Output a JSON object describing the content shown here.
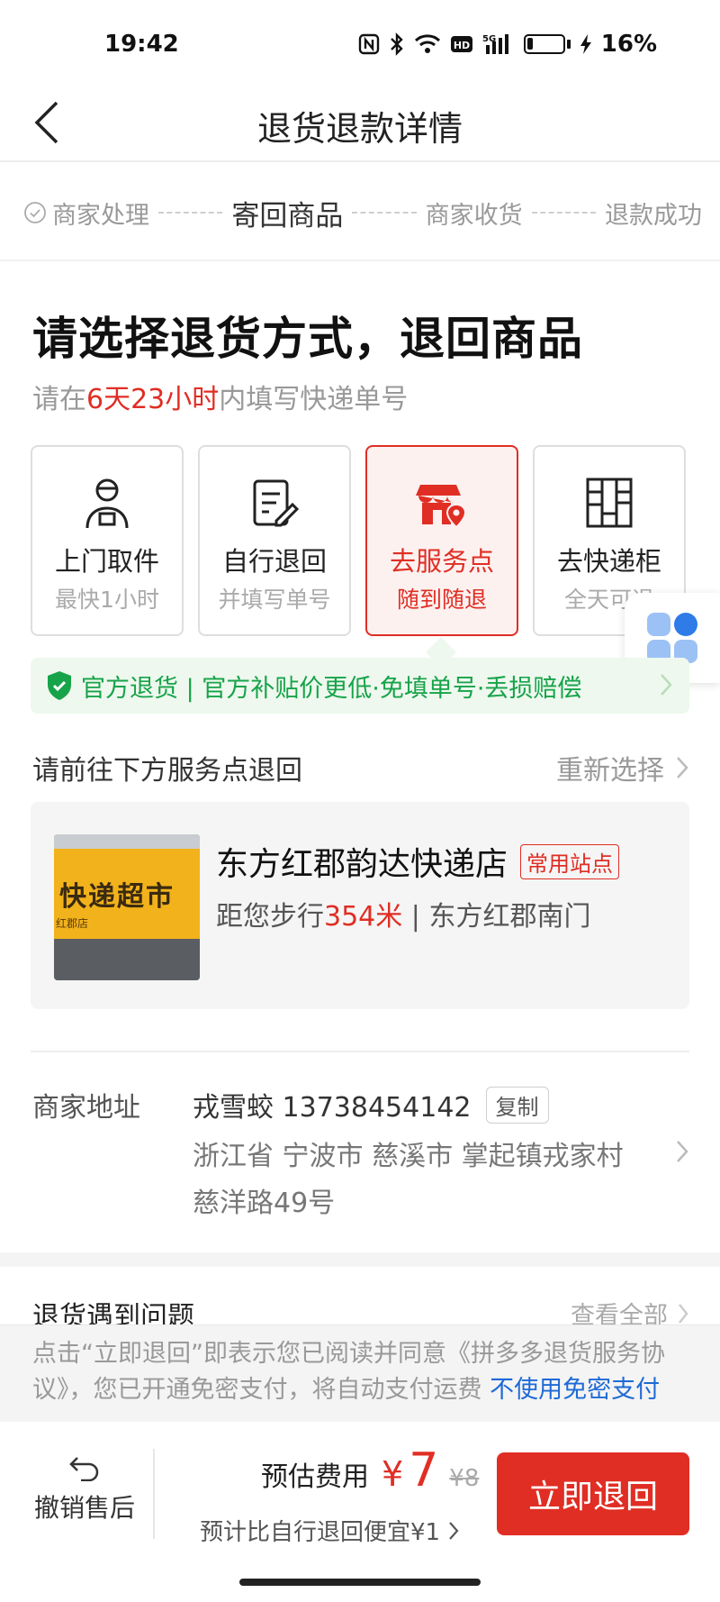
{
  "status_bar": {
    "time": "19:42",
    "battery_percent": "16%",
    "icons": [
      "nfc-icon",
      "bluetooth-icon",
      "wifi-icon",
      "hd-icon",
      "signal-5g-icon",
      "battery-icon",
      "charging-icon"
    ]
  },
  "nav": {
    "title": "退货退款详情"
  },
  "steps": [
    {
      "label": "商家处理"
    },
    {
      "label": "寄回商品"
    },
    {
      "label": "商家收货"
    },
    {
      "label": "退款成功"
    }
  ],
  "heading": {
    "title": "请选择退货方式，退回商品",
    "sub_prefix": "请在",
    "sub_deadline": "6天23小时",
    "sub_suffix": "内填写快递单号"
  },
  "methods": [
    {
      "title": "上门取件",
      "sub": "最快1小时",
      "icon": "courier-person-icon"
    },
    {
      "title": "自行退回",
      "sub": "并填写单号",
      "icon": "edit-form-icon"
    },
    {
      "title": "去服务点",
      "sub": "随到随退",
      "icon": "store-location-icon"
    },
    {
      "title": "去快递柜",
      "sub": "全天可退",
      "icon": "parcel-locker-icon"
    }
  ],
  "official": {
    "text": "官方退货 | 官方补贴价更低·免填单号·丢损赔偿"
  },
  "service_point": {
    "title": "请前往下方服务点退回",
    "reselect": "重新选择",
    "store_name": "东方红郡韵达快递店",
    "badge": "常用站点",
    "sign_text": "快递超市",
    "sign_small": "红郡店",
    "dist_prefix": "距您步行",
    "dist_value": "354米",
    "dist_suffix": " | 东方红郡南门"
  },
  "merchant_address": {
    "label": "商家地址",
    "contact": "戎雪蛟 13738454142",
    "copy": "复制",
    "address": "浙江省 宁波市 慈溪市 掌起镇戎家村慈洋路49号"
  },
  "problems": {
    "title": "退货遇到问题",
    "view_all": "查看全部"
  },
  "notice": {
    "text": "点击“立即退回”即表示您已阅读并同意《拼多多退货服务协议》，您已开通免密支付，将自动支付运费 ",
    "link": "不使用免密支付"
  },
  "bottom_bar": {
    "cancel": "撤销售后",
    "fee_label": "预估费用",
    "currency": "¥",
    "price": "7",
    "original_price": "¥8",
    "cheaper": "预计比自行退回便宜¥1",
    "return_button": "立即退回"
  }
}
